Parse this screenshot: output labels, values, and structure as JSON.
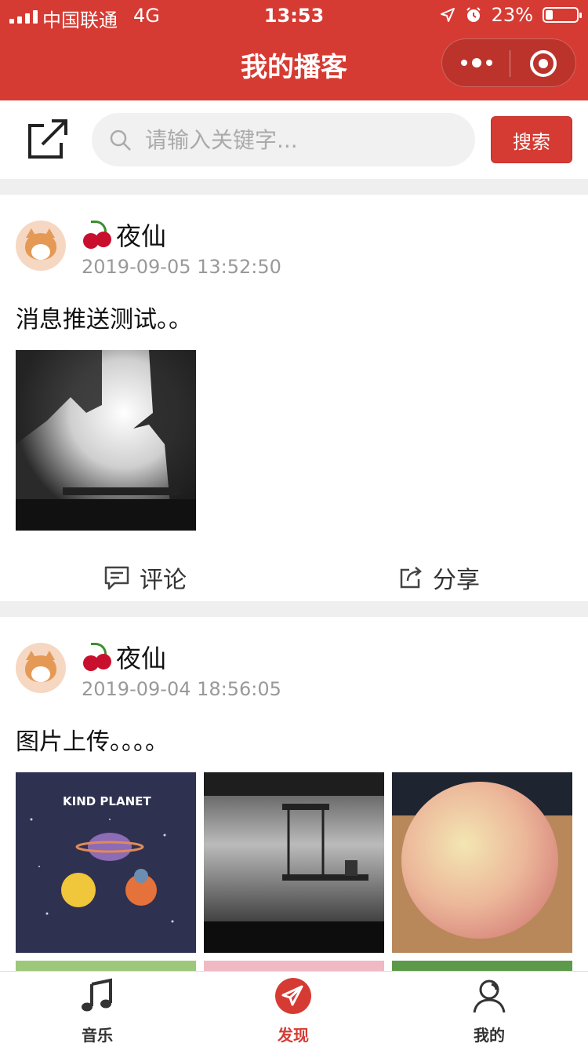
{
  "status_bar": {
    "carrier": "中国联通",
    "network": "4G",
    "time": "13:53",
    "battery": "23%",
    "battery_level": 0.23
  },
  "nav": {
    "title": "我的播客",
    "capsule_more_icon": "more-dots-icon",
    "capsule_close_icon": "target-icon"
  },
  "search": {
    "placeholder": "请输入关键字...",
    "button_label": "搜索",
    "share_icon": "external-share-icon",
    "search_icon": "magnifier-icon"
  },
  "posts": [
    {
      "user": "夜仙",
      "emoji": "cherry",
      "time": "2019-09-05 13:52:50",
      "text": "消息推送测试。。",
      "images": [
        "limbo-silhouette-light"
      ],
      "actions": {
        "comment": "评论",
        "share": "分享"
      }
    },
    {
      "user": "夜仙",
      "emoji": "cherry",
      "time": "2019-09-04 18:56:05",
      "text": "图片上传。。。。",
      "images": [
        "kind-planet-illustration",
        "limbo-platform-scene",
        "peach-photo",
        "green-landscape",
        "pink-flowers",
        "tree-landscape"
      ],
      "image_caption_0": "KIND PLANET"
    }
  ],
  "tabbar": {
    "items": [
      {
        "label": "音乐",
        "icon": "music-note-icon",
        "active": false
      },
      {
        "label": "发现",
        "icon": "paper-plane-icon",
        "active": true
      },
      {
        "label": "我的",
        "icon": "user-icon",
        "active": false
      }
    ],
    "active_color": "#d63b33"
  },
  "colors": {
    "brand_red": "#d63b33",
    "divider": "#efefef",
    "muted_text": "#999999"
  }
}
